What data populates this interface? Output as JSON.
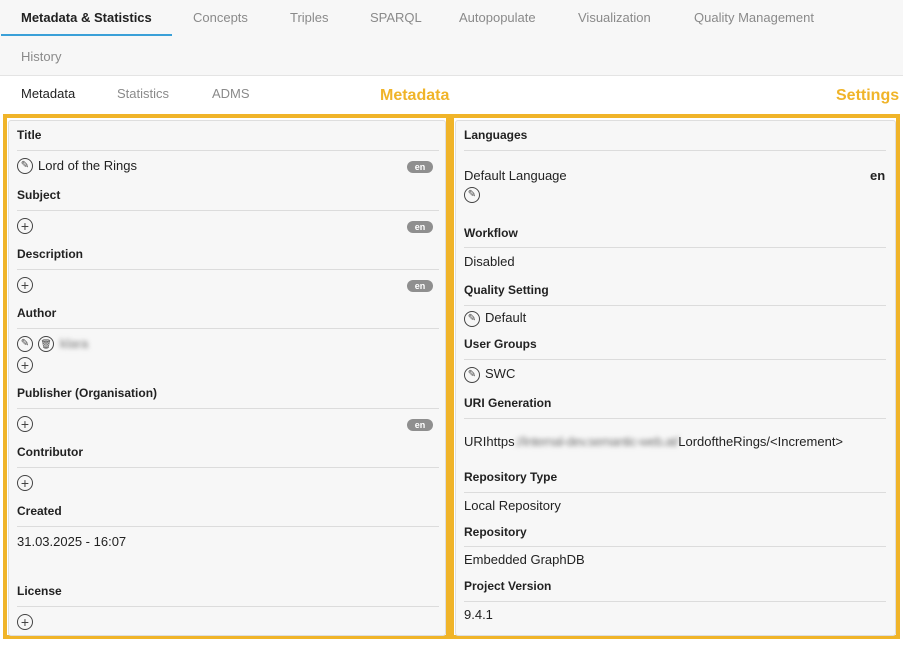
{
  "tabs": [
    {
      "label": "Metadata & Statistics"
    },
    {
      "label": "Concepts"
    },
    {
      "label": "Triples"
    },
    {
      "label": "SPARQL"
    },
    {
      "label": "Autopopulate"
    },
    {
      "label": "Visualization"
    },
    {
      "label": "Quality Management"
    },
    {
      "label": "History"
    }
  ],
  "subtabs": [
    {
      "label": "Metadata"
    },
    {
      "label": "Statistics"
    },
    {
      "label": "ADMS"
    }
  ],
  "annotations": {
    "metadata": "Metadata",
    "settings": "Settings"
  },
  "metadata": {
    "title_label": "Title",
    "title_value": "Lord of the Rings",
    "subject_label": "Subject",
    "description_label": "Description",
    "author_label": "Author",
    "author_value": "klara",
    "publisher_label": "Publisher (Organisation)",
    "contributor_label": "Contributor",
    "created_label": "Created",
    "created_value": "31.03.2025 - 16:07",
    "license_label": "License",
    "lang_badge": "en"
  },
  "settings": {
    "languages_label": "Languages",
    "default_language_label": "Default Language",
    "default_language_value": "en",
    "workflow_label": "Workflow",
    "workflow_value": "Disabled",
    "quality_setting_label": "Quality Setting",
    "quality_setting_value": "Default",
    "user_groups_label": "User Groups",
    "user_groups_value": "SWC",
    "uri_generation_label": "URI Generation",
    "uri_prefix": "URIhttps",
    "uri_blurred": "://internal-dev.semantic-web.at/",
    "uri_suffix": "LordoftheRings/<Increment>",
    "repository_type_label": "Repository Type",
    "repository_type_value": "Local Repository",
    "repository_label": "Repository",
    "repository_value": "Embedded GraphDB",
    "project_version_label": "Project Version",
    "project_version_value": "9.4.1"
  },
  "colors": {
    "annotation": "#f0b429",
    "active_tab_underline": "#3aa0d8",
    "badge": "#8f8f8f"
  },
  "icons": [
    "edit-icon",
    "add-icon",
    "delete-icon"
  ]
}
